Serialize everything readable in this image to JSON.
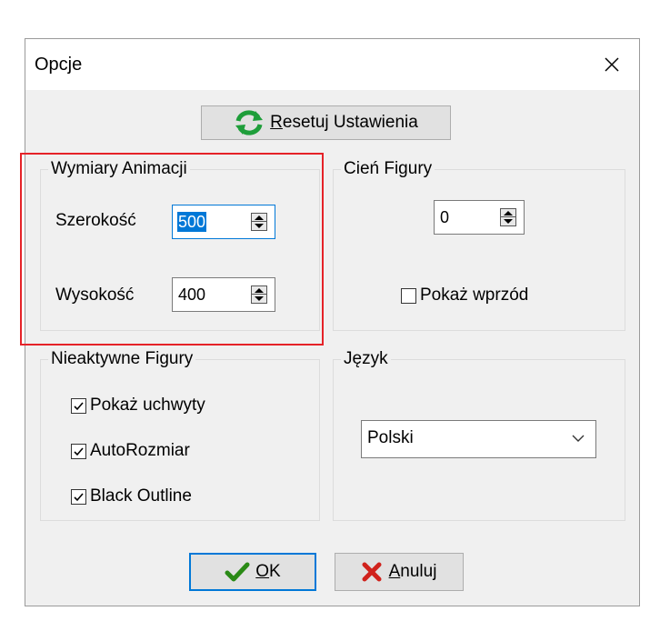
{
  "dialog": {
    "title": "Opcje"
  },
  "reset_button": {
    "label_mnemonic": "R",
    "label_rest": "esetuj Ustawienia"
  },
  "animation_dimensions": {
    "group_label": "Wymiary Animacji",
    "width_label": "Szerokość",
    "width_value": "500",
    "height_label": "Wysokość",
    "height_value": "400"
  },
  "figure_shadow": {
    "group_label": "Cień Figury",
    "value": "0",
    "show_in_front_label": "Pokaż wprzód",
    "show_in_front_checked": false
  },
  "inactive_figures": {
    "group_label": "Nieaktywne Figury",
    "options": [
      {
        "label": "Pokaż uchwyty",
        "checked": true
      },
      {
        "label": "AutoRozmiar",
        "checked": true
      },
      {
        "label": "Black Outline",
        "checked": true
      }
    ]
  },
  "language": {
    "group_label": "Język",
    "selected": "Polski"
  },
  "ok_button": {
    "label_mnemonic": "O",
    "label_rest": "K"
  },
  "cancel_button": {
    "label_mnemonic": "A",
    "label_rest": "nuluj"
  },
  "icons": {
    "refresh": "refresh-icon",
    "ok": "check-icon",
    "cancel": "x-icon",
    "close": "close-icon",
    "dropdown": "chevron-down-icon"
  },
  "colors": {
    "accent": "#0078d7",
    "refresh_green": "#1e9e3a",
    "ok_green": "#2a8a16",
    "cancel_red": "#d0221c",
    "highlight_red": "#e52228",
    "dialog_bg": "#f0f0f0"
  }
}
